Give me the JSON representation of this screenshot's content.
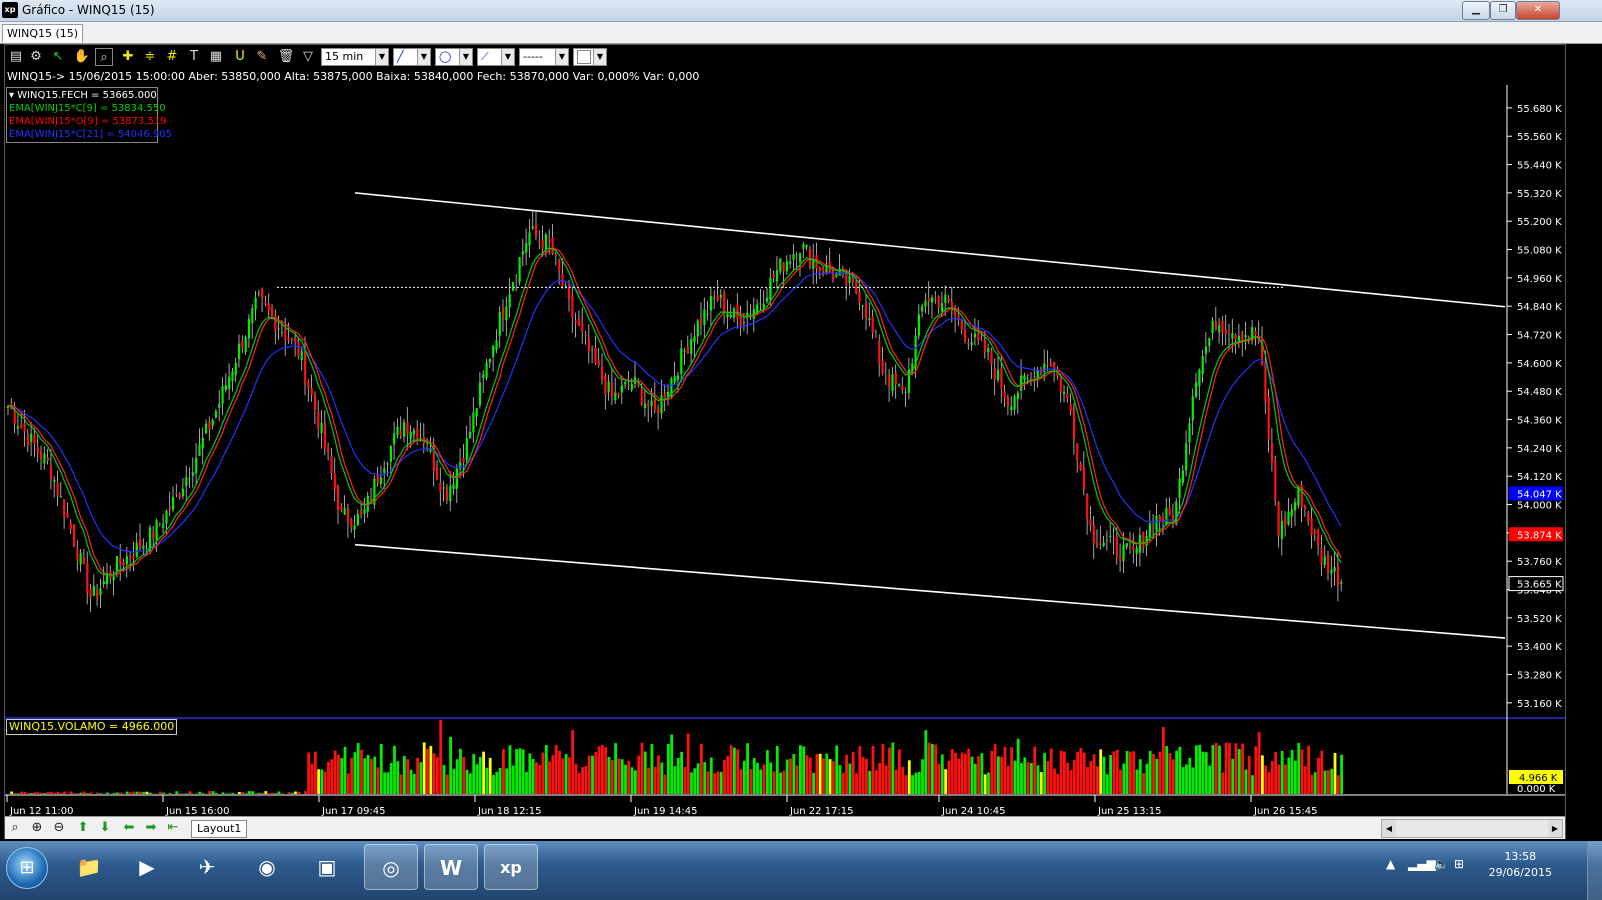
{
  "window": {
    "title": "Gráfico - WINQ15 (15)",
    "app_icon": "xp",
    "buttons": {
      "minimize": "▁",
      "maximize": "❐",
      "close": "✕"
    }
  },
  "document_tab": "WINQ15 (15)",
  "toolbar": {
    "interval": "15 min",
    "icons": [
      "chart-type-icon",
      "settings-gear-icon",
      "cursor-icon",
      "hand-icon",
      "zoom-icon",
      "crosshair-icon",
      "horizontal-lines-icon",
      "grid-lines-icon",
      "text-tool-icon",
      "calculator-icon",
      "magnet-icon",
      "paint-icon",
      "trash-icon",
      "filter-icon"
    ]
  },
  "info_line": "WINQ15-> 15/06/2015 15:00:00 Aber: 53850,000 Alta: 53875,000 Baixa: 53840,000 Fech: 53870,000 Var: 0,000% Var: 0,000",
  "legend": [
    {
      "text": "WINQ15.FECH = 53665.000",
      "color": "#ffffff"
    },
    {
      "text": "EMA[WINJ15*C[9] = 53834.550",
      "color": "#00cc00"
    },
    {
      "text": "EMA[WINJ15*O[9] = 53873.519",
      "color": "#ff0000"
    },
    {
      "text": "EMA[WINJ15*C[21] = 54046.905",
      "color": "#2233ff"
    }
  ],
  "volume_label": "WINQ15.VOLAMO = 4966.000",
  "colors": {
    "up": "#00ee00",
    "down": "#ff1111",
    "ema_fast": "#00cc00",
    "ema_open": "#ff2222",
    "ema_slow": "#2233ff",
    "channel": "#ffffff"
  },
  "chart_data": {
    "type": "candlestick",
    "symbol": "WINQ15",
    "interval": "15 min",
    "y_axis": {
      "ticks": [
        "55.680 K",
        "55.560 K",
        "55.440 K",
        "55.320 K",
        "55.200 K",
        "55.080 K",
        "54.960 K",
        "54.840 K",
        "54.720 K",
        "54.600 K",
        "54.480 K",
        "54.360 K",
        "54.240 K",
        "54.120 K",
        "54.000 K",
        "53.880 K",
        "53.760 K",
        "53.640 K",
        "53.520 K",
        "53.400 K",
        "53.280 K",
        "53.160 K"
      ],
      "ylim": [
        53100,
        55760
      ]
    },
    "price_markers": [
      {
        "label": "54.047 K",
        "value": 54047,
        "color": "#0000ff",
        "text_color": "#ffffff"
      },
      {
        "label": "53.874 K",
        "value": 53874,
        "color": "#ff0000",
        "text_color": "#ffffff"
      },
      {
        "label": "53.665 K",
        "value": 53665,
        "color": "#000000",
        "text_color": "#ffffff"
      }
    ],
    "volume_axis": {
      "ticks": [
        "0.000 K"
      ],
      "marker": {
        "label": "4.966 K",
        "color": "#ffff00"
      }
    },
    "x_axis": {
      "ticks": [
        "Jun 12 11:00",
        "Jun 15 16:00",
        "Jun 17 09:45",
        "Jun 18 12:15",
        "Jun 19 14:45",
        "Jun 22 17:15",
        "Jun 24 10:45",
        "Jun 25 13:15",
        "Jun 26 15:45"
      ]
    },
    "close_series_sampled": [
      54420,
      54280,
      54160,
      53900,
      53600,
      53720,
      53800,
      53880,
      54020,
      54200,
      54400,
      54640,
      54860,
      54760,
      54640,
      54320,
      53950,
      53940,
      54180,
      54350,
      54280,
      54040,
      54250,
      54600,
      54900,
      55150,
      55100,
      54820,
      54620,
      54450,
      54520,
      54380,
      54560,
      54750,
      54880,
      54780,
      54850,
      55000,
      55100,
      55000,
      54960,
      54880,
      54560,
      54460,
      54880,
      54860,
      54720,
      54640,
      54440,
      54540,
      54620,
      54400,
      53880,
      53820,
      53780,
      53940,
      53950,
      54550,
      54780,
      54730,
      54720,
      53880,
      54050,
      53780,
      53680
    ],
    "channel_lines": [
      {
        "name": "upper",
        "from": [
          "Jun 17 09:45",
          55320
        ],
        "to": [
          "Jun 26 15:45",
          54930
        ]
      },
      {
        "name": "lower",
        "from": [
          "Jun 17 09:45",
          53830
        ],
        "to": [
          "Jun 26 15:45",
          53510
        ]
      }
    ],
    "resistance_level": 54920,
    "volume_max": 4966
  },
  "bottom_bar": {
    "layout_tab": "Layout1",
    "icons": [
      "zoom-out-icon",
      "zoom-in-icon",
      "zoom-reset-icon",
      "arrow-up-icon",
      "arrow-down-icon",
      "arrow-left-icon",
      "arrow-right-icon",
      "arrow-end-icon"
    ]
  },
  "taskbar": {
    "time": "13:58",
    "date": "29/06/2015",
    "apps": [
      "file-explorer",
      "media-player",
      "network-tool",
      "hp-app",
      "archive-app",
      "chrome",
      "word",
      "xp-app"
    ]
  }
}
